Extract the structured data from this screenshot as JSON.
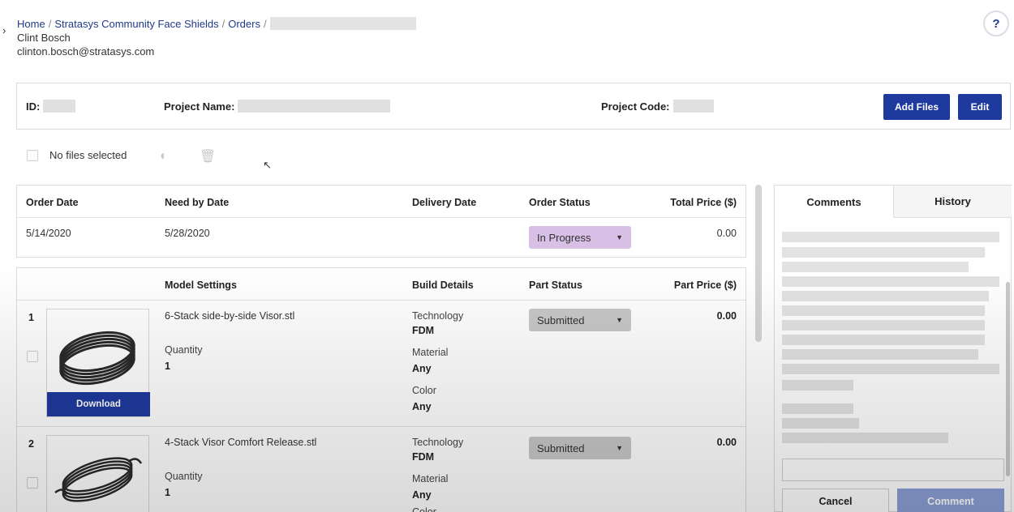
{
  "breadcrumb": {
    "home": "Home",
    "project": "Stratasys Community Face Shields",
    "orders": "Orders",
    "separator": "/"
  },
  "user": {
    "name": "Clint Bosch",
    "email": "clinton.bosch@stratasys.com"
  },
  "help_label": "?",
  "info": {
    "id_label": "ID:",
    "project_name_label": "Project Name:",
    "project_code_label": "Project Code:",
    "add_files_label": "Add Files",
    "edit_label": "Edit"
  },
  "toolbar": {
    "selection_text": "No files selected",
    "icons": [
      "cancel-file-icon",
      "trash-icon"
    ]
  },
  "order": {
    "headers": [
      "Order Date",
      "Need by Date",
      "Delivery Date",
      "Order Status",
      "Total Price ($)"
    ],
    "order_date": "5/14/2020",
    "need_by_date": "5/28/2020",
    "delivery_date": "",
    "status": "In Progress",
    "total_price": "0.00",
    "status_color": "#d7bfe5"
  },
  "parts": {
    "headers": [
      "Model Settings",
      "Build Details",
      "Part Status",
      "Part Price ($)"
    ],
    "quantity_label": "Quantity",
    "technology_label": "Technology",
    "material_label": "Material",
    "color_label": "Color",
    "download_label": "Download",
    "items": [
      {
        "index": "1",
        "file_name": "6-Stack side-by-side Visor.stl",
        "quantity": "1",
        "technology": "FDM",
        "material": "Any",
        "color": "Any",
        "status": "Submitted",
        "price": "0.00"
      },
      {
        "index": "2",
        "file_name": "4-Stack Visor Comfort Release.stl",
        "quantity": "1",
        "technology": "FDM",
        "material": "Any",
        "color": "Color",
        "status": "Submitted",
        "price": "0.00"
      }
    ]
  },
  "side_panel": {
    "tabs": [
      "Comments",
      "History"
    ],
    "cancel_label": "Cancel",
    "comment_label": "Comment"
  },
  "colors": {
    "primary": "#1f3a9e",
    "link": "#1f3a8a"
  }
}
